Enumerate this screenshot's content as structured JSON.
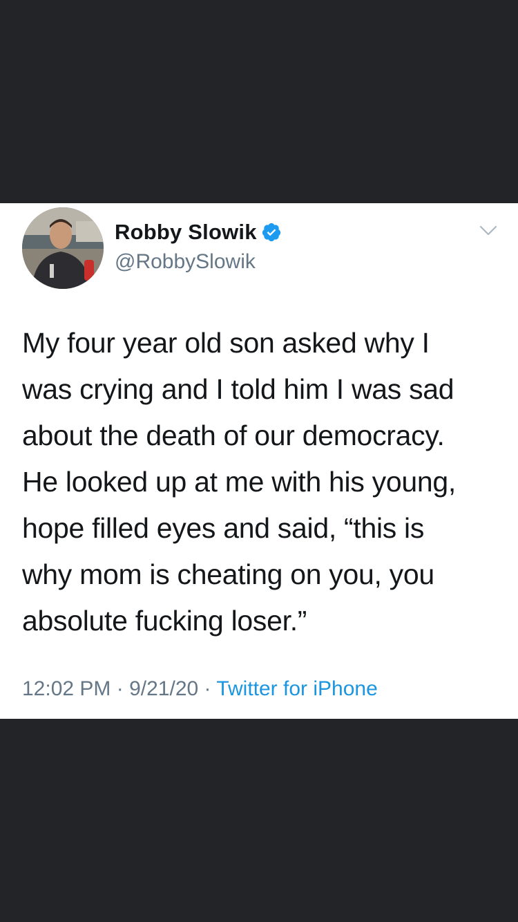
{
  "tweet": {
    "author": {
      "name": "Robby Slowik",
      "handle": "@RobbySlowik",
      "verified": true
    },
    "text_lines": [
      "My four year old son asked why I",
      "was crying and I told him I was sad",
      "about the death of our democracy.",
      "He looked up at me with his young,",
      "hope filled eyes and said, “this is",
      "why mom is cheating on you, you",
      "absolute fucking loser.”"
    ],
    "time": "12:02 PM",
    "separator": " · ",
    "date": "9/21/20",
    "source": "Twitter for iPhone"
  },
  "icons": {
    "verified": "verified-badge-icon",
    "caret": "chevron-down-icon"
  },
  "colors": {
    "background": "#232427",
    "card": "#ffffff",
    "text": "#14171a",
    "secondary": "#657786",
    "accent": "#1b95e0"
  }
}
